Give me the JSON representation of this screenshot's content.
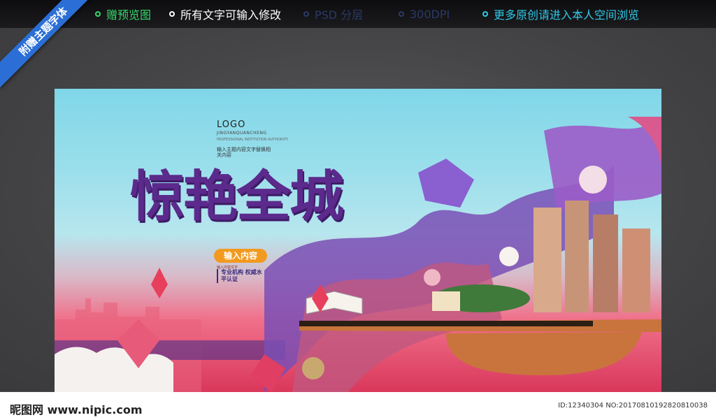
{
  "topbar": {
    "features": [
      {
        "label": "赠预览图",
        "color": "#38d96a"
      },
      {
        "label": "所有文字可输入修改",
        "color": "#ffffff"
      },
      {
        "label": "PSD 分层",
        "color": "#2b3a66"
      },
      {
        "label": "300DPI",
        "color": "#2b3a66"
      },
      {
        "label": "更多原创请进入本人空间浏览",
        "color": "#2fc8e8"
      }
    ]
  },
  "ribbon": {
    "label": "附赠主题字体"
  },
  "poster": {
    "logo": "LOGO",
    "subtitle_en": "JINGYANQUANCHENG",
    "subtitle_tiny": "PROFESSIONAL INSTITUTION AUTHORITY",
    "subtitle_cn": "输入主题内容文字替换相关内容",
    "headline": "惊艳全城",
    "badge": "输入内容",
    "tiny_label": "输入内容文字",
    "box_text": "专业机构 权威水平认证"
  },
  "footer": {
    "site": "昵图网 www.nipic.com",
    "id": "ID:12340304 NO:20170810192820810038"
  },
  "colors": {
    "headline": "#5b2a8c",
    "badge": "#f29a1f",
    "ribbon": "#2b6fd6"
  }
}
